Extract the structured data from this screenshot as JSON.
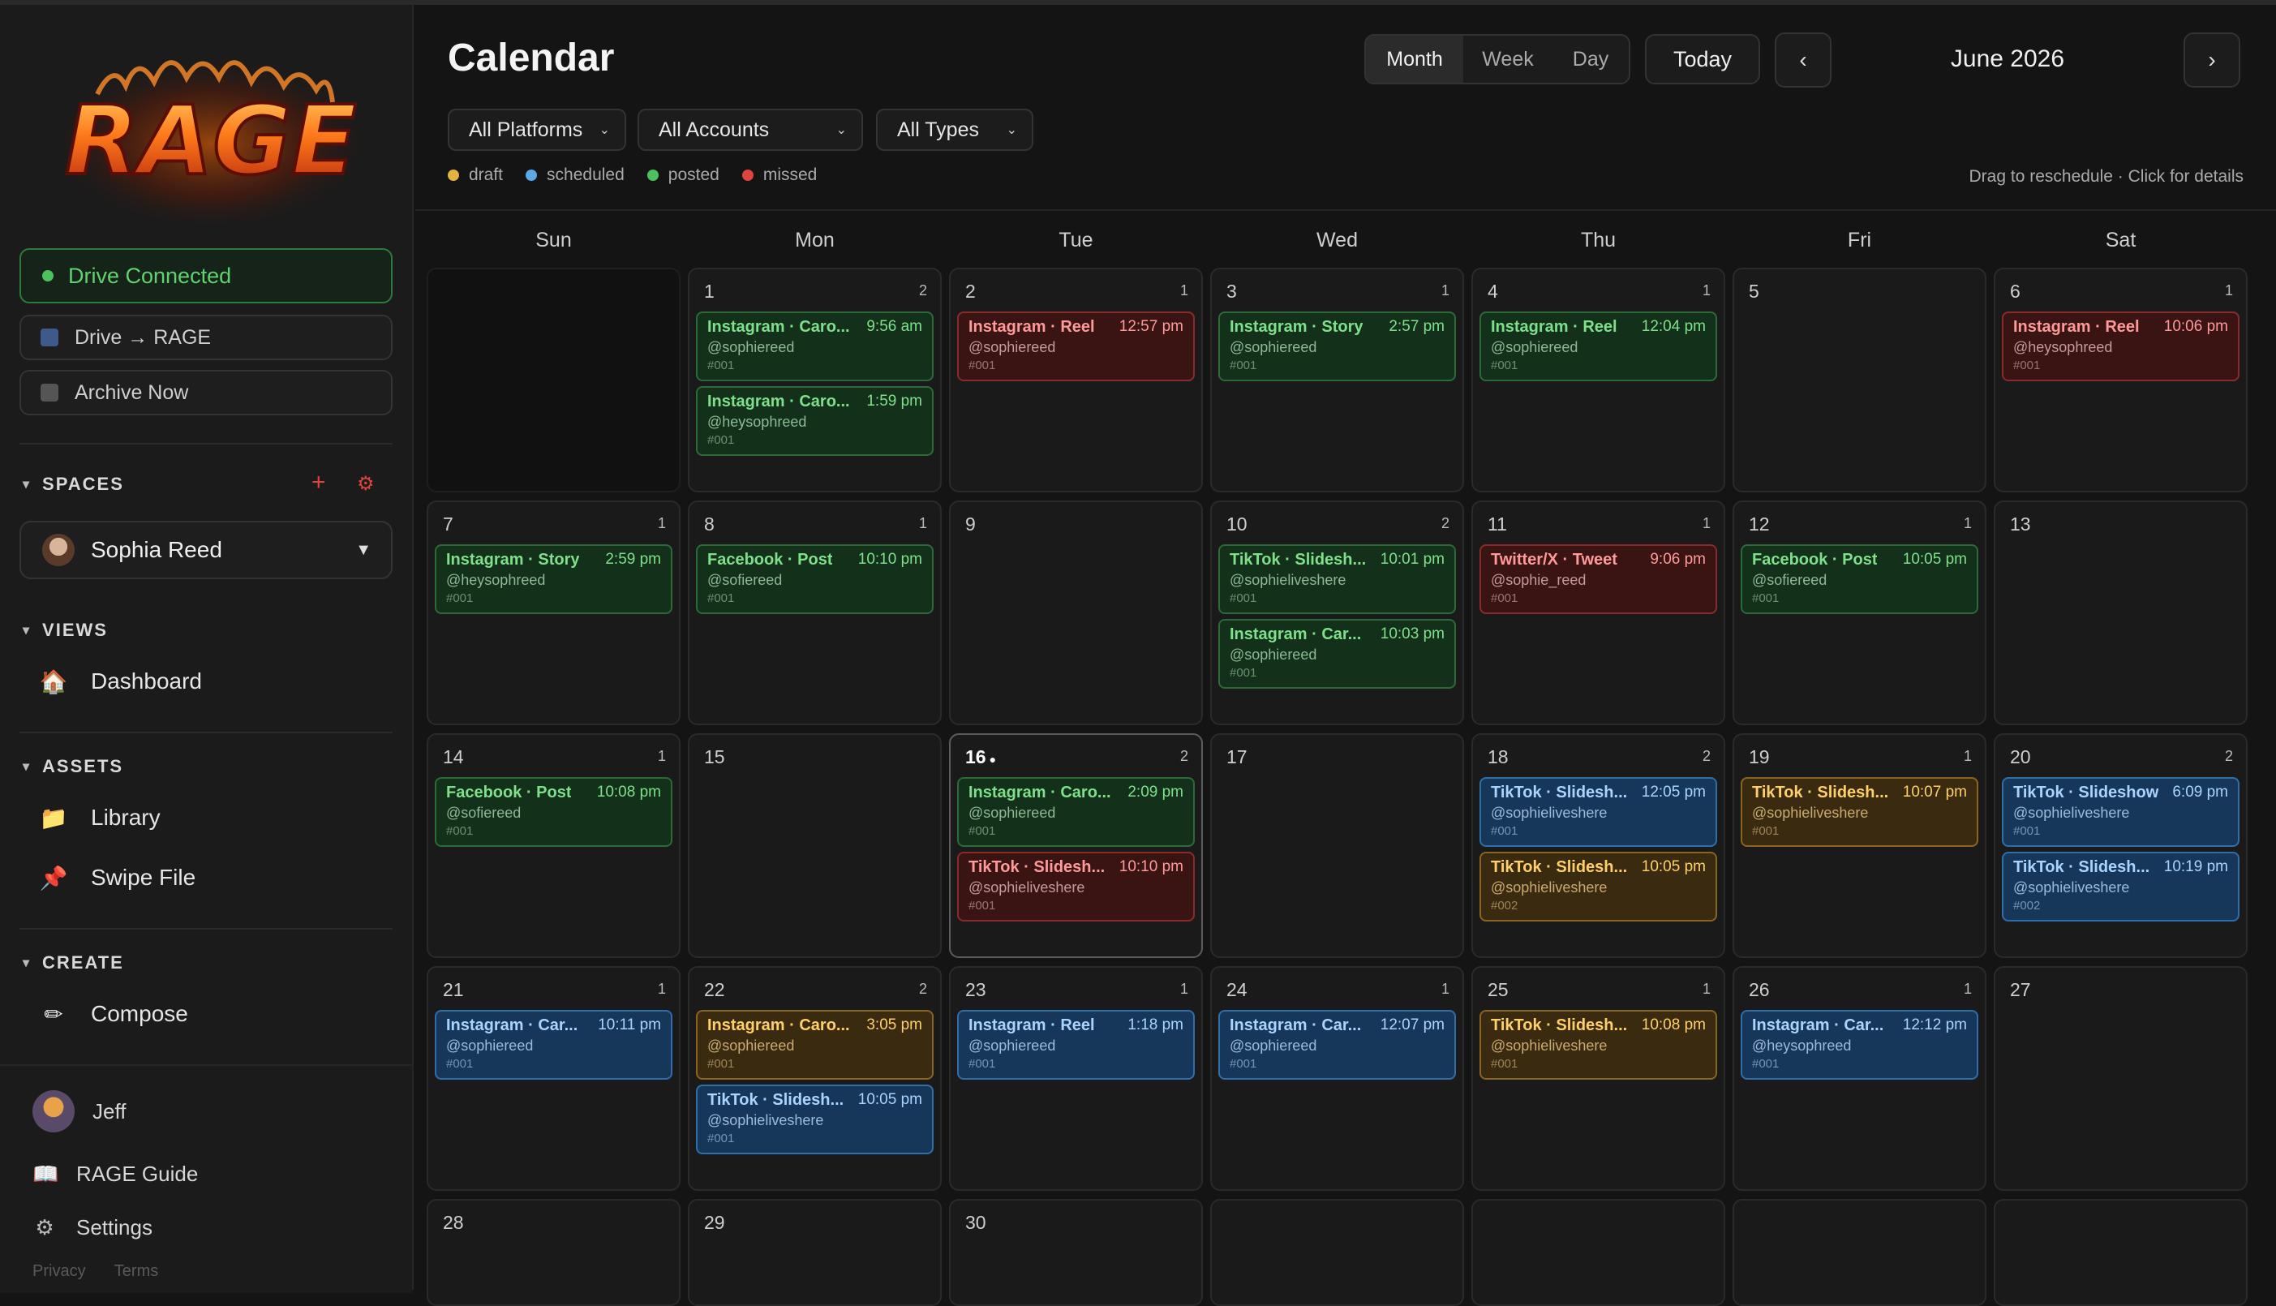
{
  "app": {
    "logo_text": "RAGE"
  },
  "sidebar": {
    "drive_status": "Drive Connected",
    "drive_sync": "Drive → RAGE",
    "archive": "Archive Now",
    "spaces_title": "SPACES",
    "space_selected": "Sophia Reed",
    "views_title": "VIEWS",
    "dashboard": "Dashboard",
    "assets_title": "ASSETS",
    "library": "Library",
    "swipe_file": "Swipe File",
    "create_title": "CREATE",
    "compose": "Compose",
    "user": "Jeff",
    "guide": "RAGE Guide",
    "settings": "Settings",
    "privacy": "Privacy",
    "terms": "Terms"
  },
  "header": {
    "title": "Calendar",
    "views": [
      "Month",
      "Week",
      "Day"
    ],
    "active_view": "Month",
    "today": "Today",
    "prev": "‹",
    "next": "›",
    "month": "June 2026"
  },
  "filters": {
    "platforms": "All Platforms",
    "accounts": "All Accounts",
    "types": "All Types"
  },
  "legend": [
    {
      "label": "draft",
      "color": "#e3b341"
    },
    {
      "label": "scheduled",
      "color": "#5aa9e6"
    },
    {
      "label": "posted",
      "color": "#4cc25e"
    },
    {
      "label": "missed",
      "color": "#e0443e"
    }
  ],
  "hint": "Drag to reschedule · Click for details",
  "weekdays": [
    "Sun",
    "Mon",
    "Tue",
    "Wed",
    "Thu",
    "Fri",
    "Sat"
  ],
  "weeks": [
    [
      {
        "day": "",
        "count": "",
        "events": []
      },
      {
        "day": "1",
        "count": "2",
        "events": [
          {
            "title": "Instagram · Caro...",
            "time": "9:56 am",
            "account": "@sophiereed",
            "num": "#001",
            "status": "posted"
          },
          {
            "title": "Instagram · Caro...",
            "time": "1:59 pm",
            "account": "@heysophreed",
            "num": "#001",
            "status": "posted"
          }
        ]
      },
      {
        "day": "2",
        "count": "1",
        "events": [
          {
            "title": "Instagram · Reel",
            "time": "12:57 pm",
            "account": "@sophiereed",
            "num": "#001",
            "status": "missed"
          }
        ]
      },
      {
        "day": "3",
        "count": "1",
        "events": [
          {
            "title": "Instagram · Story",
            "time": "2:57 pm",
            "account": "@sophiereed",
            "num": "#001",
            "status": "posted"
          }
        ]
      },
      {
        "day": "4",
        "count": "1",
        "events": [
          {
            "title": "Instagram · Reel",
            "time": "12:04 pm",
            "account": "@sophiereed",
            "num": "#001",
            "status": "posted"
          }
        ]
      },
      {
        "day": "5",
        "count": "",
        "events": []
      },
      {
        "day": "6",
        "count": "1",
        "events": [
          {
            "title": "Instagram · Reel",
            "time": "10:06 pm",
            "account": "@heysophreed",
            "num": "#001",
            "status": "missed"
          }
        ]
      }
    ],
    [
      {
        "day": "7",
        "count": "1",
        "events": [
          {
            "title": "Instagram · Story",
            "time": "2:59 pm",
            "account": "@heysophreed",
            "num": "#001",
            "status": "posted"
          }
        ]
      },
      {
        "day": "8",
        "count": "1",
        "events": [
          {
            "title": "Facebook · Post",
            "time": "10:10 pm",
            "account": "@sofiereed",
            "num": "#001",
            "status": "posted"
          }
        ]
      },
      {
        "day": "9",
        "count": "",
        "events": []
      },
      {
        "day": "10",
        "count": "2",
        "events": [
          {
            "title": "TikTok · Slidesh...",
            "time": "10:01 pm",
            "account": "@sophieliveshere",
            "num": "#001",
            "status": "posted"
          },
          {
            "title": "Instagram · Car...",
            "time": "10:03 pm",
            "account": "@sophiereed",
            "num": "#001",
            "status": "posted"
          }
        ]
      },
      {
        "day": "11",
        "count": "1",
        "events": [
          {
            "title": "Twitter/X · Tweet",
            "time": "9:06 pm",
            "account": "@sophie_reed",
            "num": "#001",
            "status": "missed"
          }
        ]
      },
      {
        "day": "12",
        "count": "1",
        "events": [
          {
            "title": "Facebook · Post",
            "time": "10:05 pm",
            "account": "@sofiereed",
            "num": "#001",
            "status": "posted"
          }
        ]
      },
      {
        "day": "13",
        "count": "",
        "events": []
      }
    ],
    [
      {
        "day": "14",
        "count": "1",
        "events": [
          {
            "title": "Facebook · Post",
            "time": "10:08 pm",
            "account": "@sofiereed",
            "num": "#001",
            "status": "posted"
          }
        ]
      },
      {
        "day": "15",
        "count": "",
        "events": []
      },
      {
        "day": "16",
        "today_marker": "●",
        "count": "2",
        "events": [
          {
            "title": "Instagram · Caro...",
            "time": "2:09 pm",
            "account": "@sophiereed",
            "num": "#001",
            "status": "posted"
          },
          {
            "title": "TikTok · Slidesh...",
            "time": "10:10 pm",
            "account": "@sophieliveshere",
            "num": "#001",
            "status": "missed"
          }
        ]
      },
      {
        "day": "17",
        "count": "",
        "events": []
      },
      {
        "day": "18",
        "count": "2",
        "events": [
          {
            "title": "TikTok · Slidesh...",
            "time": "12:05 pm",
            "account": "@sophieliveshere",
            "num": "#001",
            "status": "scheduled"
          },
          {
            "title": "TikTok · Slidesh...",
            "time": "10:05 pm",
            "account": "@sophieliveshere",
            "num": "#002",
            "status": "draft"
          }
        ]
      },
      {
        "day": "19",
        "count": "1",
        "events": [
          {
            "title": "TikTok · Slidesh...",
            "time": "10:07 pm",
            "account": "@sophieliveshere",
            "num": "#001",
            "status": "draft"
          }
        ]
      },
      {
        "day": "20",
        "count": "2",
        "events": [
          {
            "title": "TikTok · Slideshow",
            "time": "6:09 pm",
            "account": "@sophieliveshere",
            "num": "#001",
            "status": "scheduled"
          },
          {
            "title": "TikTok · Slidesh...",
            "time": "10:19 pm",
            "account": "@sophieliveshere",
            "num": "#002",
            "status": "scheduled"
          }
        ]
      }
    ],
    [
      {
        "day": "21",
        "count": "1",
        "events": [
          {
            "title": "Instagram · Car...",
            "time": "10:11 pm",
            "account": "@sophiereed",
            "num": "#001",
            "status": "scheduled"
          }
        ]
      },
      {
        "day": "22",
        "count": "2",
        "events": [
          {
            "title": "Instagram · Caro...",
            "time": "3:05 pm",
            "account": "@sophiereed",
            "num": "#001",
            "status": "draft"
          },
          {
            "title": "TikTok · Slidesh...",
            "time": "10:05 pm",
            "account": "@sophieliveshere",
            "num": "#001",
            "status": "scheduled"
          }
        ]
      },
      {
        "day": "23",
        "count": "1",
        "events": [
          {
            "title": "Instagram · Reel",
            "time": "1:18 pm",
            "account": "@sophiereed",
            "num": "#001",
            "status": "scheduled"
          }
        ]
      },
      {
        "day": "24",
        "count": "1",
        "events": [
          {
            "title": "Instagram · Car...",
            "time": "12:07 pm",
            "account": "@sophiereed",
            "num": "#001",
            "status": "scheduled"
          }
        ]
      },
      {
        "day": "25",
        "count": "1",
        "events": [
          {
            "title": "TikTok · Slidesh...",
            "time": "10:08 pm",
            "account": "@sophieliveshere",
            "num": "#001",
            "status": "draft"
          }
        ]
      },
      {
        "day": "26",
        "count": "1",
        "events": [
          {
            "title": "Instagram · Car...",
            "time": "12:12 pm",
            "account": "@heysophreed",
            "num": "#001",
            "status": "scheduled"
          }
        ]
      },
      {
        "day": "27",
        "count": "",
        "events": []
      }
    ],
    [
      {
        "day": "28",
        "count": "",
        "events": []
      },
      {
        "day": "29",
        "count": "",
        "events": []
      },
      {
        "day": "30",
        "count": "",
        "events": []
      },
      {
        "day": "",
        "count": "",
        "events": []
      },
      {
        "day": "",
        "count": "",
        "events": []
      },
      {
        "day": "",
        "count": "",
        "events": []
      },
      {
        "day": "",
        "count": "",
        "events": []
      }
    ]
  ]
}
